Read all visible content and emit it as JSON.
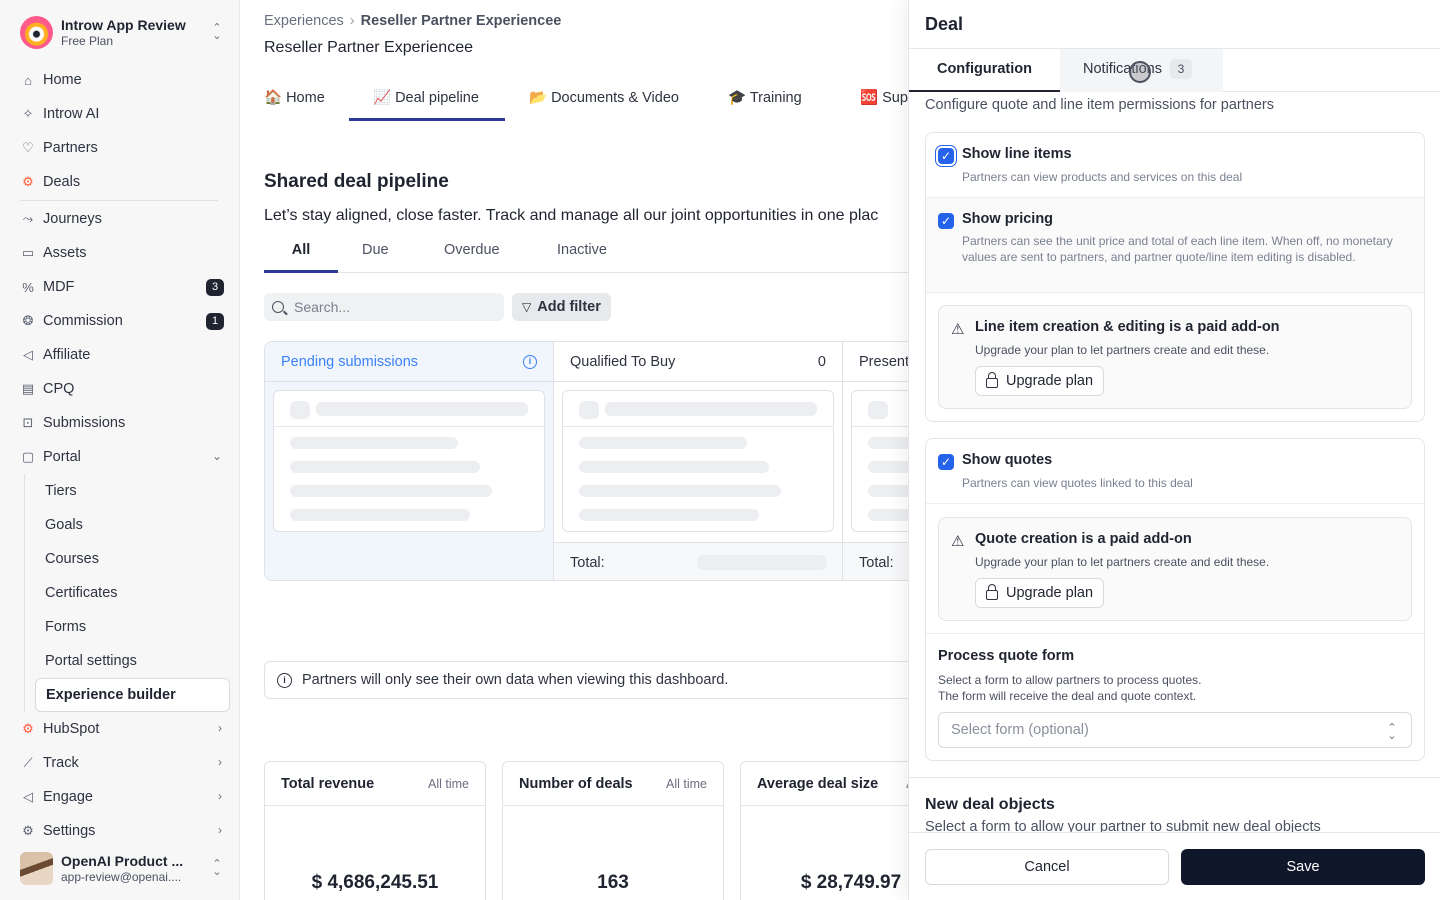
{
  "workspace": {
    "name": "Introw App Review",
    "plan": "Free Plan"
  },
  "nav": {
    "home": "Home",
    "introw_ai": "Introw AI",
    "partners": "Partners",
    "deals": "Deals",
    "journeys": "Journeys",
    "assets": "Assets",
    "mdf": "MDF",
    "mdf_badge": "3",
    "commission": "Commission",
    "commission_badge": "1",
    "affiliate": "Affiliate",
    "cpq": "CPQ",
    "submissions": "Submissions",
    "portal": "Portal",
    "portal_sub": {
      "tiers": "Tiers",
      "goals": "Goals",
      "courses": "Courses",
      "certificates": "Certificates",
      "forms": "Forms",
      "portal_settings": "Portal settings",
      "experience_builder": "Experience builder"
    },
    "hubspot": "HubSpot",
    "track": "Track",
    "engage": "Engage",
    "settings": "Settings"
  },
  "user": {
    "name": "OpenAI Product ...",
    "email": "app-review@openai...."
  },
  "breadcrumb": {
    "root": "Experiences",
    "current": "Reseller Partner Experiencee"
  },
  "page_title": "Reseller Partner Experiencee",
  "page_tabs": [
    {
      "label": "🏠 Home"
    },
    {
      "label": "📈 Deal pipeline"
    },
    {
      "label": "📂 Documents & Video"
    },
    {
      "label": "🎓 Training"
    },
    {
      "label": "🆘 Supp"
    }
  ],
  "section": {
    "title": "Shared deal pipeline",
    "description": "Let’s stay aligned, close faster. Track and manage all our joint opportunities in one plac"
  },
  "filter_tabs": {
    "all": "All",
    "due": "Due",
    "overdue": "Overdue",
    "inactive": "Inactive"
  },
  "search": {
    "placeholder": "Search..."
  },
  "add_filter": "Add filter",
  "board": {
    "pending": "Pending submissions",
    "qualified": "Qualified To Buy",
    "qualified_count": "0",
    "presentation": "Present",
    "total_label": "Total:"
  },
  "notice": "Partners will only see their own data when viewing this dashboard.",
  "metrics": [
    {
      "title": "Total revenue",
      "range": "All time",
      "value": "$ 4,686,245.51"
    },
    {
      "title": "Number of deals",
      "range": "All time",
      "value": "163"
    },
    {
      "title": "Average deal size",
      "range": "A",
      "value": "$ 28,749.97"
    }
  ],
  "panel": {
    "title": "Deal",
    "tab_configuration": "Configuration",
    "tab_notifications": "Notifications",
    "notifications_count": "3",
    "description": "Configure quote and line item permissions for partners",
    "show_line_items": {
      "title": "Show line items",
      "desc": "Partners can view products and services on this deal",
      "checked": true
    },
    "show_pricing": {
      "title": "Show pricing",
      "desc": "Partners can see the unit price and total of each line item. When off, no monetary values are sent to partners, and partner quote/line item editing is disabled.",
      "checked": true
    },
    "line_item_addon": {
      "title": "Line item creation & editing is a paid add-on",
      "desc": "Upgrade your plan to let partners create and edit these.",
      "button": "Upgrade plan"
    },
    "show_quotes": {
      "title": "Show quotes",
      "desc": "Partners can view quotes linked to this deal",
      "checked": true
    },
    "quote_addon": {
      "title": "Quote creation is a paid add-on",
      "desc": "Upgrade your plan to let partners create and edit these.",
      "button": "Upgrade plan"
    },
    "process_quote": {
      "title": "Process quote form",
      "desc_line1": "Select a form to allow partners to process quotes.",
      "desc_line2": "The form will receive the deal and quote context.",
      "select_placeholder": "Select form (optional)"
    },
    "new_deal_objects": {
      "title": "New deal objects",
      "desc": "Select a form to allow your partner to submit new deal objects"
    },
    "cancel": "Cancel",
    "save": "Save"
  },
  "colors": {
    "accent": "#2563eb",
    "tab_underline": "#2c3a9a",
    "save_button": "#0f172a",
    "hubspot": "#ff5c35"
  }
}
